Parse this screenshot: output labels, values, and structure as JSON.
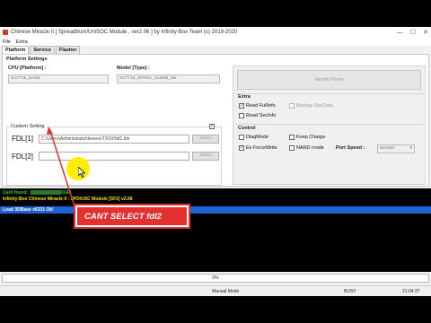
{
  "window": {
    "title": "Chinese Miracle II [ Spreadtrum/UniSOC Module , ver2.06 ] by Infinity-Box Team (c) 2019-2020"
  },
  "menu": [
    "File",
    "Extra"
  ],
  "tabs": [
    "Platform",
    "Service",
    "Flasher"
  ],
  "platform": {
    "group_title": "Platform Settings",
    "cpu_label": "CPU [Platform] :",
    "cpu_value": "SC7715_BASE",
    "model_label": "Model [Type] :",
    "model_value": "SC7715_SPRSC_512MB_BB",
    "custom_title": "Custom Setting",
    "fdl1_label": "FDL[1]",
    "fdl1_value": "C:\\Users\\Administrator\\lenovo\\TXXX\\fdl1.bin",
    "fdl2_label": "FDL[2]",
    "fdl2_value": "",
    "select_label": "Select"
  },
  "right": {
    "identify_label": "Identify Phone",
    "extra_title": "Extra",
    "read_fullinfo": "Read FullInfo",
    "backup_secdata": "Backup SecData",
    "read_secinfo": "Read SecInfo",
    "control_title": "Control",
    "diagmode": "DiagMode",
    "keep_charge": "Keep Charge",
    "ex_forcewrite": "Ex ForceWrite",
    "nand_mode": "NAND mode",
    "port_speed_label": "Port Speed :",
    "port_speed_value": "921600",
    "check_mark": "✓"
  },
  "console": {
    "line1_prefix": "Card found : ",
    "line1_suffix": "0148",
    "line2": "Infinity-Box Chinese Miracle II : SPD/USC Module [SF2] v2.08",
    "line3": "Load 3DBase v6331 Ok!"
  },
  "annotation": "CANT  SELECT fdl2",
  "progress_label": "0%",
  "status": {
    "mode": "Manual Mode",
    "state": "BUSY",
    "time": "21:04:37"
  }
}
